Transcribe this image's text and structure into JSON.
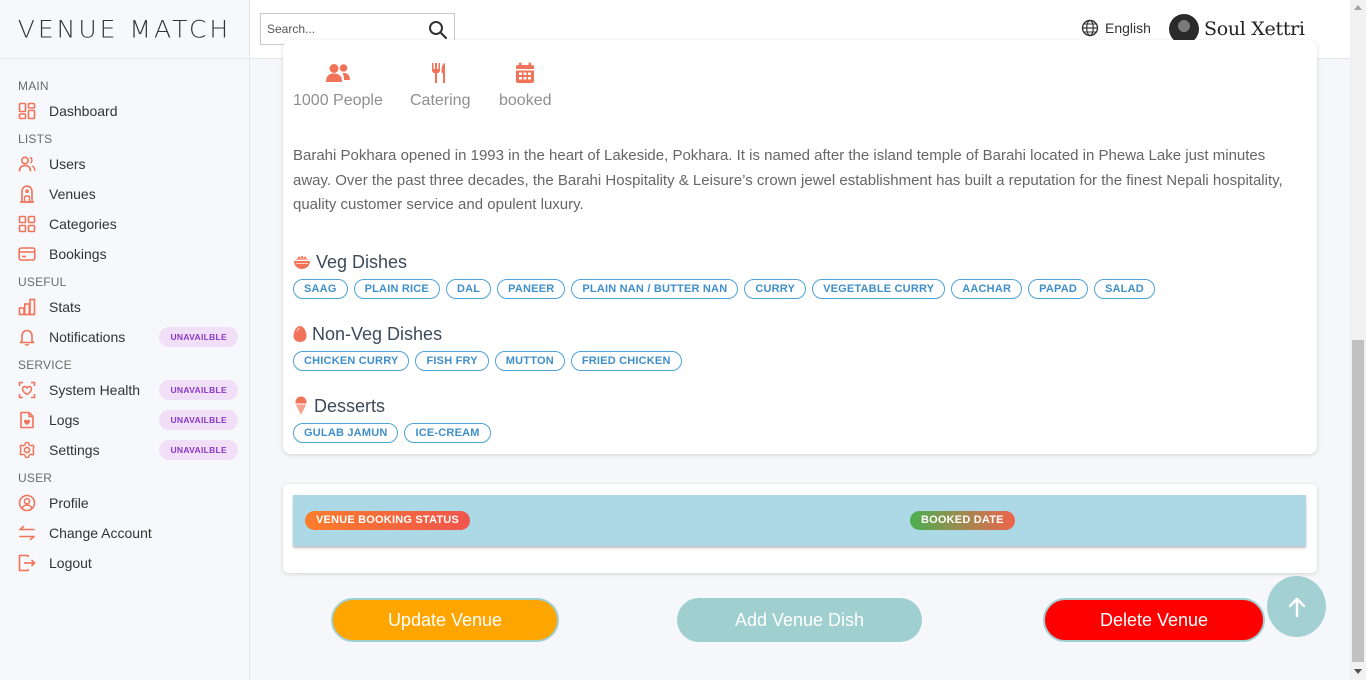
{
  "app": {
    "logo": "VENUE MATCH"
  },
  "search": {
    "placeholder": "Search..."
  },
  "header": {
    "language": "English",
    "user_name": "Soul Xettri"
  },
  "sidebar": {
    "sections": [
      {
        "title": "MAIN",
        "items": [
          {
            "label": "Dashboard",
            "icon": "dashboard-icon"
          }
        ]
      },
      {
        "title": "LISTS",
        "items": [
          {
            "label": "Users",
            "icon": "users-icon"
          },
          {
            "label": "Venues",
            "icon": "venue-icon"
          },
          {
            "label": "Categories",
            "icon": "categories-icon"
          },
          {
            "label": "Bookings",
            "icon": "bookings-icon"
          }
        ]
      },
      {
        "title": "USEFUL",
        "items": [
          {
            "label": "Stats",
            "icon": "stats-icon"
          },
          {
            "label": "Notifications",
            "icon": "bell-icon",
            "badge": "UNAVAILBLE"
          }
        ]
      },
      {
        "title": "SERVICE",
        "items": [
          {
            "label": "System Health",
            "icon": "health-icon",
            "badge": "UNAVAILBLE"
          },
          {
            "label": "Logs",
            "icon": "logs-icon",
            "badge": "UNAVAILBLE"
          },
          {
            "label": "Settings",
            "icon": "gear-icon",
            "badge": "UNAVAILBLE"
          }
        ]
      },
      {
        "title": "USER",
        "items": [
          {
            "label": "Profile",
            "icon": "profile-icon"
          },
          {
            "label": "Change Account",
            "icon": "swap-icon"
          },
          {
            "label": "Logout",
            "icon": "logout-icon"
          }
        ]
      }
    ]
  },
  "venue": {
    "features": [
      {
        "text": "1000 People",
        "icon": "people-icon"
      },
      {
        "text": "Catering",
        "icon": "cutlery-icon"
      },
      {
        "text": "booked",
        "icon": "calendar-icon"
      }
    ],
    "description": "Barahi Pokhara opened in 1993 in the heart of Lakeside, Pokhara. It is named after the island temple of Barahi located in Phewa Lake just minutes away. Over the past three decades, the Barahi Hospitality & Leisure’s crown jewel establishment has built a reputation for the finest Nepali hospitality, quality customer service and opulent luxury.",
    "dish_groups": [
      {
        "title": "Veg Dishes",
        "icon": "bowl-icon",
        "dishes": [
          "SAAG",
          "PLAIN RICE",
          "DAL",
          "PANEER",
          "PLAIN NAN / BUTTER NAN",
          "CURRY",
          "VEGETABLE CURRY",
          "AACHAR",
          "PAPAD",
          "SALAD"
        ]
      },
      {
        "title": "Non-Veg Dishes",
        "icon": "egg-icon",
        "dishes": [
          "CHICKEN CURRY",
          "FISH FRY",
          "MUTTON",
          "FRIED CHICKEN"
        ]
      },
      {
        "title": "Desserts",
        "icon": "icecream-icon",
        "dishes": [
          "GULAB JAMUN",
          "ICE-CREAM"
        ]
      }
    ]
  },
  "booking": {
    "status_label": "VENUE BOOKING STATUS",
    "date_label": "BOOKED DATE"
  },
  "actions": {
    "update": "Update Venue",
    "add_dish": "Add Venue Dish",
    "delete": "Delete Venue"
  },
  "colors": {
    "accent": "#f0735a",
    "update_button": "#ffa500",
    "add_dish_button": "#9fcfcf",
    "delete_button": "#ff0000",
    "chip_border": "#4ea3d8",
    "booking_bar": "#add8e6"
  }
}
